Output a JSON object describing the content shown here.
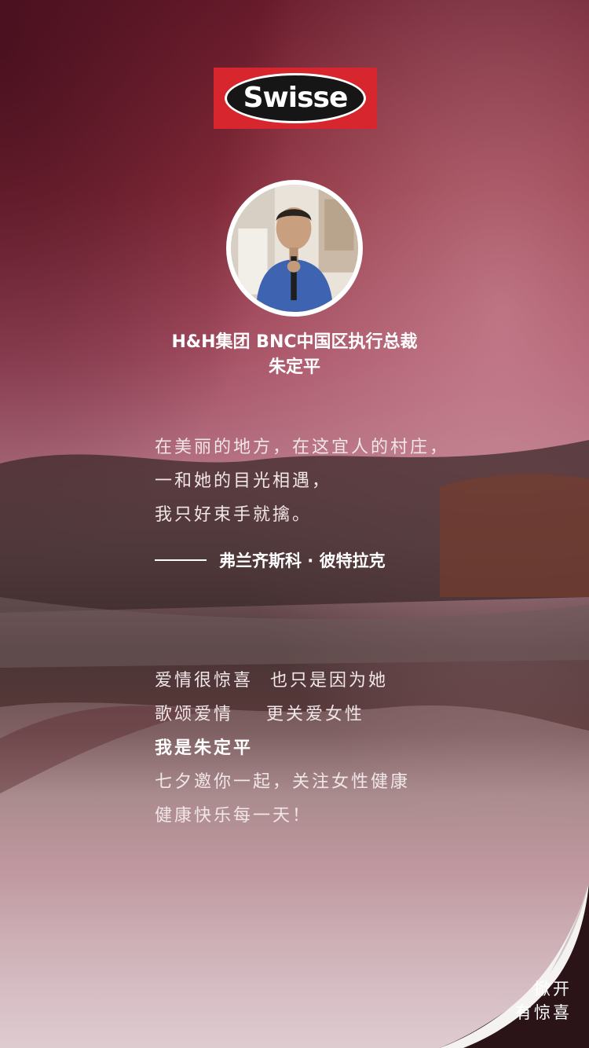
{
  "brand": {
    "logo_text": "Swisse"
  },
  "speaker": {
    "title_line1": "H&H集团 BNC中国区执行总裁",
    "title_line2": "朱定平"
  },
  "quote": {
    "lines": [
      "在美丽的地方，在这宜人的村庄，",
      "一和她的目光相遇，",
      "我只好束手就擒。"
    ],
    "author": "弗兰齐斯科 · 彼特拉克"
  },
  "message": {
    "line1_a": "爱情很惊喜",
    "line1_b": "也只是因为她",
    "line2_a": "歌颂爱情",
    "line2_b": "更关爱女性",
    "line3": "我是朱定平",
    "line4": "七夕邀你一起，关注女性健康",
    "line5": "健康快乐每一天！"
  },
  "page_curl": {
    "line1": "掀开",
    "line2": "有惊喜"
  },
  "colors": {
    "brand_red": "#d7262e",
    "logo_black": "#161616",
    "sky_crimson": "#8a2d3c",
    "curl_dark": "#2a1418"
  }
}
